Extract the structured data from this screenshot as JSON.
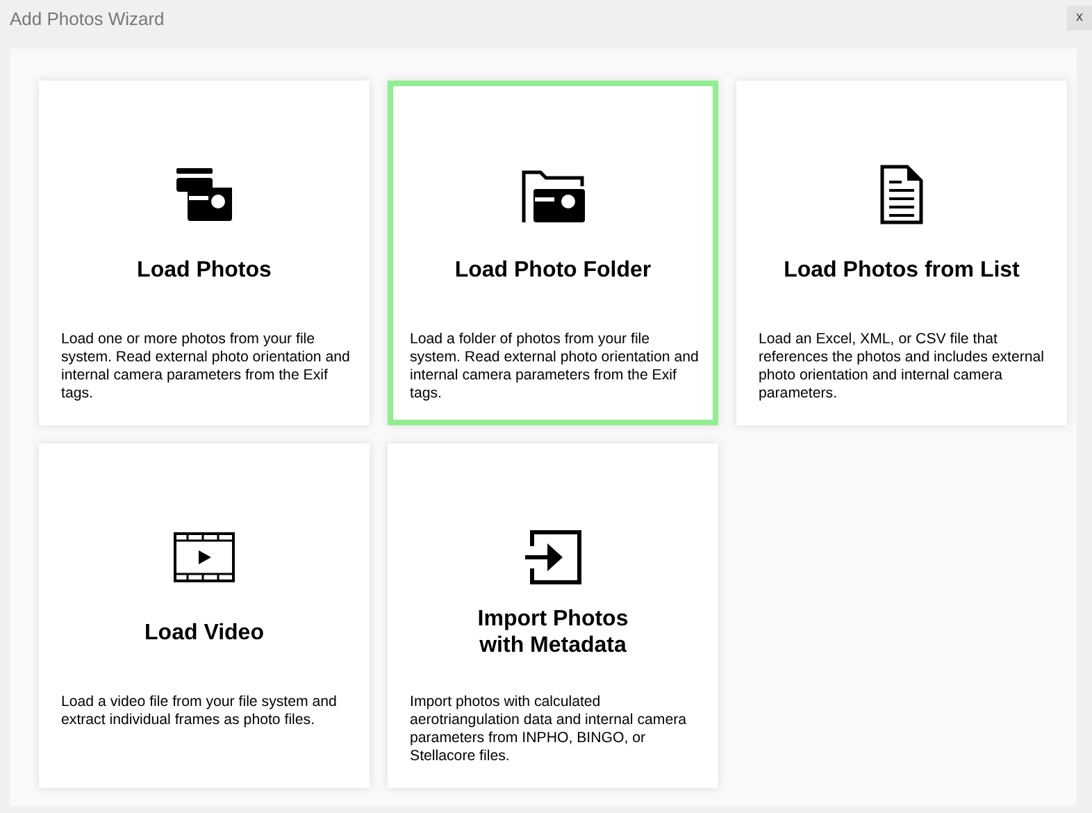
{
  "window": {
    "title": "Add Photos Wizard",
    "close": "x"
  },
  "options": [
    {
      "kind": "photos",
      "title": "Load Photos",
      "description": "Load one or more photos from your file system. Read external photo orientation and internal camera parameters from the Exif tags.",
      "selected": false
    },
    {
      "kind": "folder",
      "title": "Load Photo Folder",
      "description": "Load a folder of photos from your file system. Read external photo orientation and internal camera parameters from the Exif tags.",
      "selected": true
    },
    {
      "kind": "list",
      "title": "Load Photos from List",
      "description": "Load an Excel, XML, or CSV file that references the photos and includes external photo orientation and internal camera parameters.",
      "selected": false
    },
    {
      "kind": "video",
      "title": "Load Video",
      "description": "Load a video file from your file system and extract individual frames as photo files.",
      "selected": false
    },
    {
      "kind": "import",
      "title": "Import Photos\nwith Metadata",
      "description": "Import photos with calculated aerotriangulation data and internal camera parameters from INPHO, BINGO, or Stellacore files.",
      "selected": false
    }
  ]
}
